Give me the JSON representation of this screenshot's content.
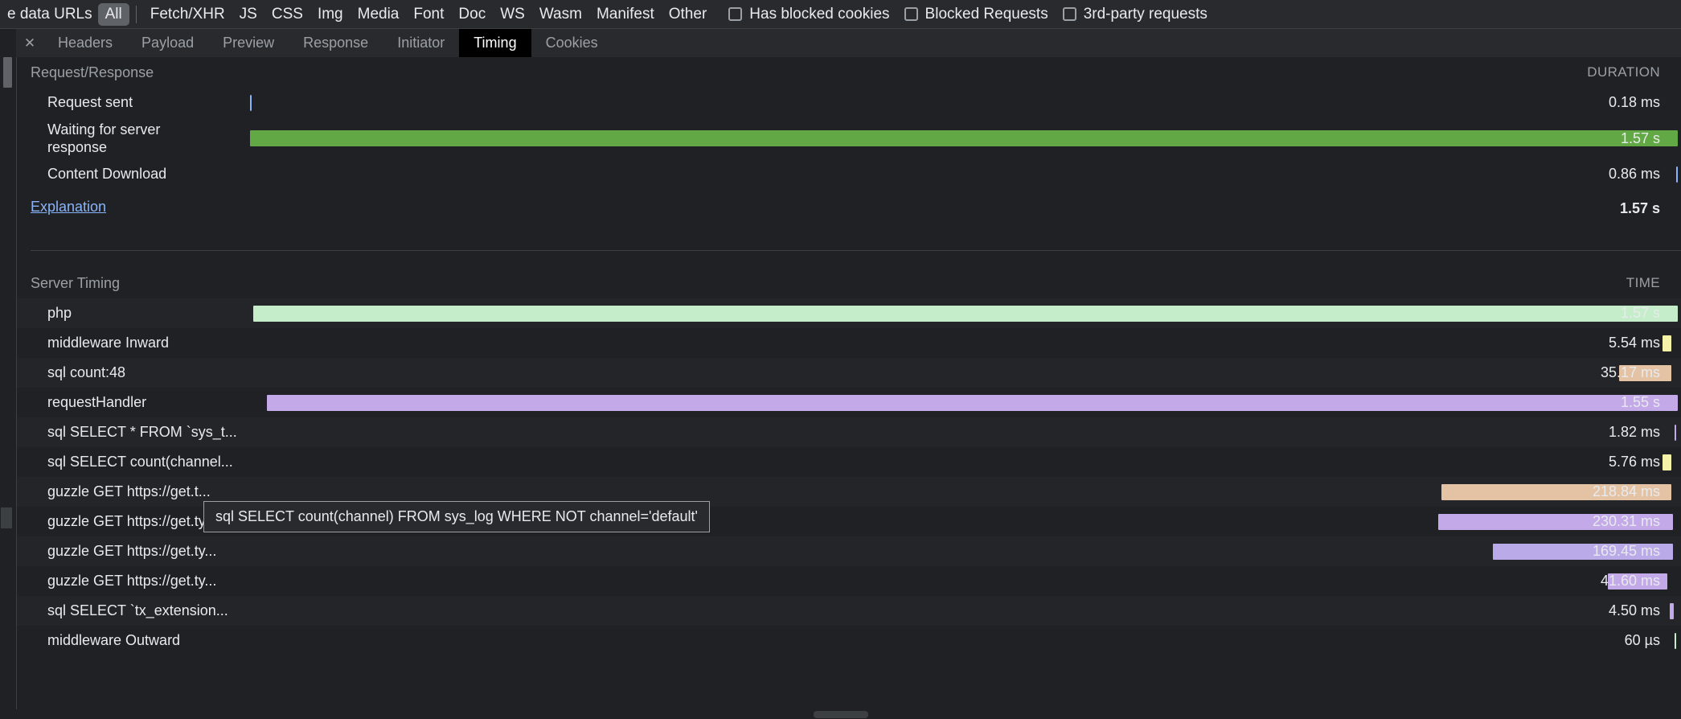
{
  "filter_bar": {
    "prefix_label": "e data URLs",
    "types": [
      "All",
      "Fetch/XHR",
      "JS",
      "CSS",
      "Img",
      "Media",
      "Font",
      "Doc",
      "WS",
      "Wasm",
      "Manifest",
      "Other"
    ],
    "active_type": "All",
    "checkboxes": [
      {
        "label": "Has blocked cookies",
        "checked": false
      },
      {
        "label": "Blocked Requests",
        "checked": false
      },
      {
        "label": "3rd-party requests",
        "checked": false
      }
    ]
  },
  "tab_bar": {
    "close_icon": "close-icon",
    "tabs": [
      "Headers",
      "Payload",
      "Preview",
      "Response",
      "Initiator",
      "Timing",
      "Cookies"
    ],
    "selected_tab": "Timing"
  },
  "request_response": {
    "section_title": "Request/Response",
    "column_header": "DURATION",
    "rows": [
      {
        "label": "Request sent",
        "duration": "0.18 ms",
        "bar_left_pct": 14.0,
        "bar_width_pct": 0.14,
        "color": "#8ab4f8"
      },
      {
        "label": "Waiting for server\nresponse",
        "duration": "1.57 s",
        "bar_left_pct": 14.0,
        "bar_width_pct": 85.8,
        "color": "#62a844"
      },
      {
        "label": "Content Download",
        "duration": "0.86 ms",
        "bar_left_pct": 99.7,
        "bar_width_pct": 0.14,
        "color": "#8ab4f8"
      }
    ],
    "explanation_link": "Explanation",
    "total": "1.57 s"
  },
  "server_timing": {
    "section_title": "Server Timing",
    "column_header": "TIME",
    "rows": [
      {
        "label": "php",
        "time": "1.57 s",
        "bar_left_pct": 14.2,
        "bar_width_pct": 85.6,
        "color": "#c5edc9"
      },
      {
        "label": "middleware Inward",
        "time": "5.54 ms",
        "bar_left_pct": 98.9,
        "bar_width_pct": 0.5,
        "color": "#f5f3a8"
      },
      {
        "label": "sql count:48",
        "time": "35.17 ms",
        "bar_left_pct": 96.3,
        "bar_width_pct": 3.1,
        "color": "#e4c3a5"
      },
      {
        "label": "requestHandler",
        "time": "1.55 s",
        "bar_left_pct": 15.0,
        "bar_width_pct": 84.8,
        "color": "#c3a9e8"
      },
      {
        "label": "sql SELECT * FROM `sys_t...",
        "time": "1.82 ms",
        "bar_left_pct": 99.6,
        "bar_width_pct": 0.14,
        "color": "#c3a9e8"
      },
      {
        "label": "sql SELECT count(channel...",
        "time": "5.76 ms",
        "bar_left_pct": 98.9,
        "bar_width_pct": 0.5,
        "color": "#f5f3a8"
      },
      {
        "label": "guzzle GET https://get.t...",
        "time": "218.84 ms",
        "bar_left_pct": 85.6,
        "bar_width_pct": 13.8,
        "color": "#e4c3a5"
      },
      {
        "label": "guzzle GET https://get.ty...",
        "time": "230.31 ms",
        "bar_left_pct": 85.4,
        "bar_width_pct": 14.1,
        "color": "#c3a9e8"
      },
      {
        "label": "guzzle GET https://get.ty...",
        "time": "169.45 ms",
        "bar_left_pct": 88.7,
        "bar_width_pct": 10.8,
        "color": "#bbaae8"
      },
      {
        "label": "guzzle GET https://get.ty...",
        "time": "41.60 ms",
        "bar_left_pct": 95.6,
        "bar_width_pct": 3.6,
        "color": "#c3a9e8"
      },
      {
        "label": "sql SELECT `tx_extension...",
        "time": "4.50 ms",
        "bar_left_pct": 99.3,
        "bar_width_pct": 0.25,
        "color": "#c3a9e8"
      },
      {
        "label": "middleware Outward",
        "time": "60 µs",
        "bar_left_pct": 99.6,
        "bar_width_pct": 0.1,
        "color": "#c5edc9"
      }
    ]
  },
  "tooltip": {
    "text": "sql SELECT count(channel) FROM sys_log WHERE NOT channel='default'"
  },
  "colors": {
    "background": "#202124",
    "chrome": "#292a2d",
    "link": "#8ab4f8",
    "muted_text": "#9aa0a6",
    "text": "#e8eaed",
    "selected_tab_bg": "#000000"
  }
}
